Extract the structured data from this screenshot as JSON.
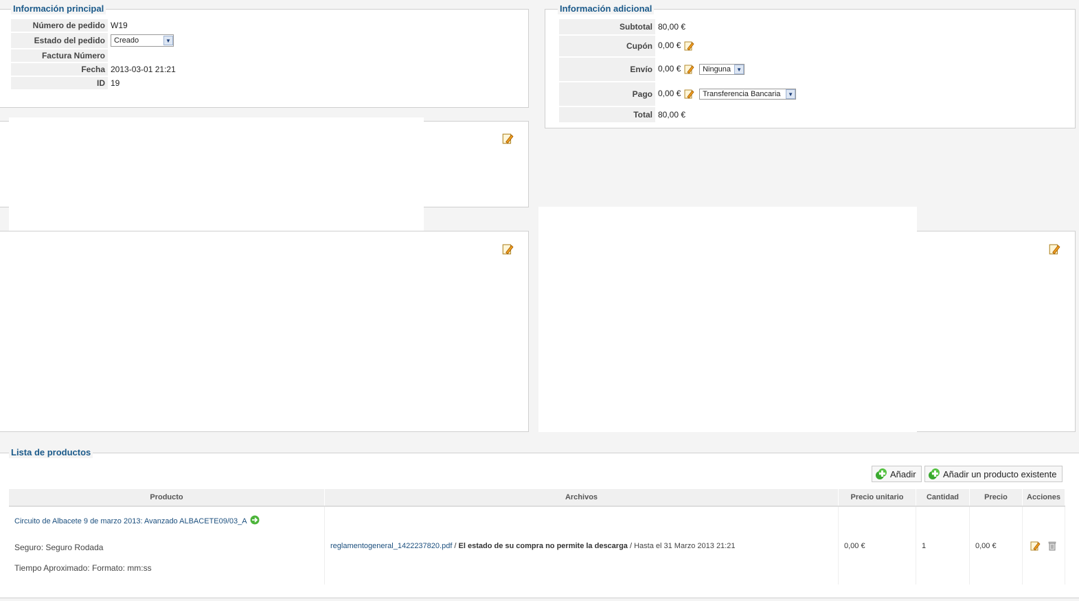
{
  "main_info": {
    "legend": "Información principal",
    "rows": [
      {
        "label": "Número de pedido",
        "value": "W19"
      },
      {
        "label": "Estado del pedido",
        "value": "Creado"
      },
      {
        "label": "Factura Número",
        "value": ""
      },
      {
        "label": "Fecha",
        "value": "2013-03-01 21:21"
      },
      {
        "label": "ID",
        "value": "19"
      }
    ]
  },
  "extra_info": {
    "legend": "Información adicional",
    "subtotal_label": "Subtotal",
    "subtotal_value": "80,00 €",
    "coupon_label": "Cupón",
    "coupon_value": "0,00 €",
    "shipping_label": "Envío",
    "shipping_value": "0,00 €",
    "shipping_method": "Ninguna",
    "payment_label": "Pago",
    "payment_value": "0,00 €",
    "payment_method": "Transferencia Bancaria",
    "total_label": "Total",
    "total_value": "80,00 €"
  },
  "products": {
    "legend": "Lista de productos",
    "add_label": "Añadir",
    "add_existing_label": "Añadir un producto existente",
    "columns": [
      "Producto",
      "Archivos",
      "Precio unitario",
      "Cantidad",
      "Precio",
      "Acciones"
    ],
    "rows": [
      {
        "product_name": "Circuito de Albacete 9 de marzo 2013: Avanzado ALBACETE09/03_A",
        "option_1": "Seguro: Seguro Rodada",
        "option_2": "Tiempo Aproximado: Formato: mm:ss",
        "file_name": "reglamentogeneral_1422237820.pdf",
        "file_sep": " / ",
        "file_status": "El estado de su compra no permite la descarga",
        "file_sep2": " / ",
        "file_until": "Hasta el 31 Marzo 2013 21:21",
        "unit_price": "0,00 €",
        "quantity": "1",
        "price": "0,00 €"
      }
    ]
  },
  "icons": {
    "edit": "pencil-icon",
    "add": "green-plus-icon",
    "go": "green-arrow-icon",
    "delete": "trash-icon"
  }
}
